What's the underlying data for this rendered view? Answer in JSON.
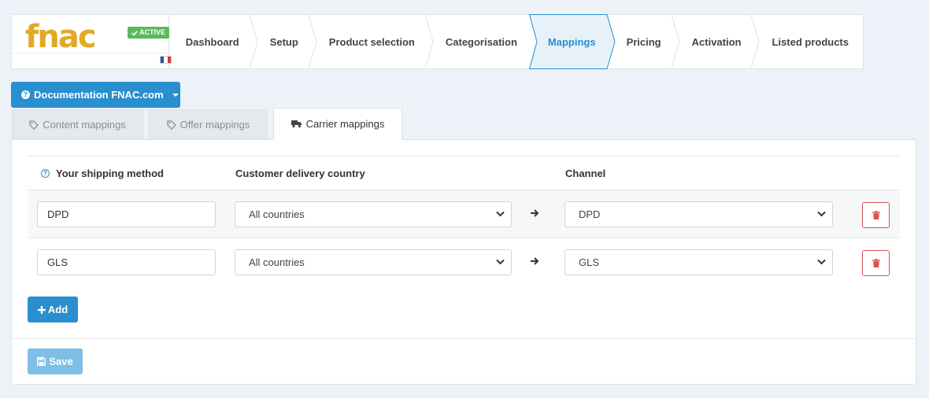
{
  "brand": {
    "logo_text": "fnac",
    "status_badge": "ACTIVE",
    "colors": {
      "logo": "#e1a925",
      "badge": "#5cb85c",
      "accent": "#2a8fce"
    }
  },
  "steps": [
    {
      "label": "Dashboard",
      "active": false
    },
    {
      "label": "Setup",
      "active": false
    },
    {
      "label": "Product selection",
      "active": false
    },
    {
      "label": "Categorisation",
      "active": false
    },
    {
      "label": "Mappings",
      "active": true
    },
    {
      "label": "Pricing",
      "active": false
    },
    {
      "label": "Activation",
      "active": false
    },
    {
      "label": "Listed products",
      "active": false
    }
  ],
  "documentation": {
    "label": "Documentation FNAC.com"
  },
  "tabs": [
    {
      "label": "Content mappings",
      "active": false
    },
    {
      "label": "Offer mappings",
      "active": false
    },
    {
      "label": "Carrier mappings",
      "active": true
    }
  ],
  "table": {
    "headers": {
      "shipping_method": "Your shipping method",
      "country": "Customer delivery country",
      "channel": "Channel"
    },
    "rows": [
      {
        "shipping_method": "DPD",
        "country": "All countries",
        "channel": "DPD"
      },
      {
        "shipping_method": "GLS",
        "country": "All countries",
        "channel": "GLS"
      }
    ]
  },
  "actions": {
    "add_label": "Add",
    "save_label": "Save"
  }
}
